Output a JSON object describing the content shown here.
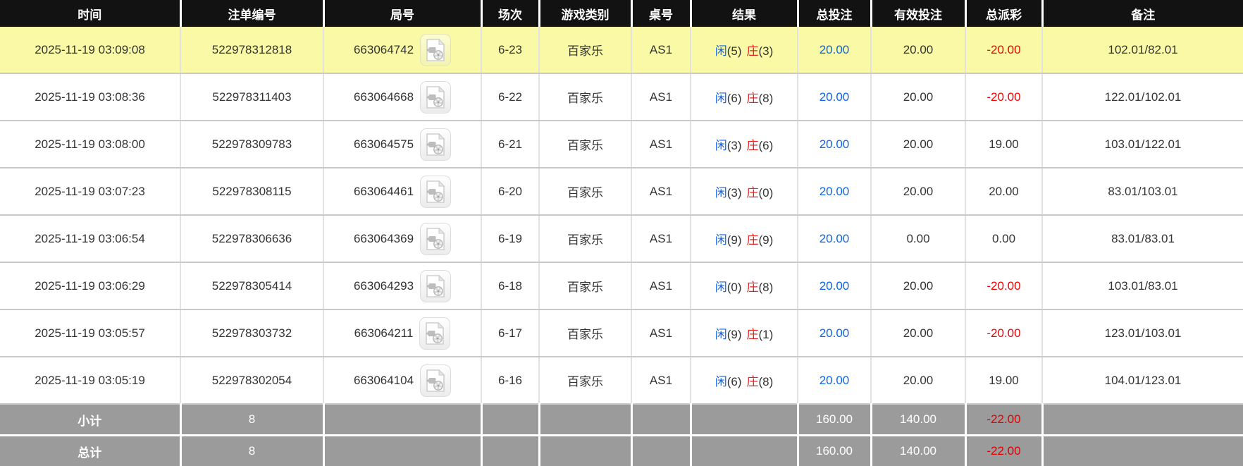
{
  "table": {
    "columns": [
      {
        "label": "时间"
      },
      {
        "label": "注单编号"
      },
      {
        "label": "局号"
      },
      {
        "label": "场次"
      },
      {
        "label": "游戏类别"
      },
      {
        "label": "桌号"
      },
      {
        "label": "结果"
      },
      {
        "label": "总投注"
      },
      {
        "label": "有效投注"
      },
      {
        "label": "总派彩"
      },
      {
        "label": "备注"
      }
    ],
    "result_labels": {
      "player": "闲",
      "banker": "庄"
    },
    "rows": [
      {
        "time": "2025-11-19 03:09:08",
        "bet_id": "522978312818",
        "round_id": "663064742",
        "session": "6-23",
        "game_type": "百家乐",
        "table_no": "AS1",
        "player": "5",
        "banker": "3",
        "total_bet": "20.00",
        "valid_bet": "20.00",
        "payout": "-20.00",
        "remark": "102.01/82.01",
        "highlighted": true
      },
      {
        "time": "2025-11-19 03:08:36",
        "bet_id": "522978311403",
        "round_id": "663064668",
        "session": "6-22",
        "game_type": "百家乐",
        "table_no": "AS1",
        "player": "6",
        "banker": "8",
        "total_bet": "20.00",
        "valid_bet": "20.00",
        "payout": "-20.00",
        "remark": "122.01/102.01",
        "highlighted": false
      },
      {
        "time": "2025-11-19 03:08:00",
        "bet_id": "522978309783",
        "round_id": "663064575",
        "session": "6-21",
        "game_type": "百家乐",
        "table_no": "AS1",
        "player": "3",
        "banker": "6",
        "total_bet": "20.00",
        "valid_bet": "20.00",
        "payout": "19.00",
        "remark": "103.01/122.01",
        "highlighted": false
      },
      {
        "time": "2025-11-19 03:07:23",
        "bet_id": "522978308115",
        "round_id": "663064461",
        "session": "6-20",
        "game_type": "百家乐",
        "table_no": "AS1",
        "player": "3",
        "banker": "0",
        "total_bet": "20.00",
        "valid_bet": "20.00",
        "payout": "20.00",
        "remark": "83.01/103.01",
        "highlighted": false
      },
      {
        "time": "2025-11-19 03:06:54",
        "bet_id": "522978306636",
        "round_id": "663064369",
        "session": "6-19",
        "game_type": "百家乐",
        "table_no": "AS1",
        "player": "9",
        "banker": "9",
        "total_bet": "20.00",
        "valid_bet": "0.00",
        "payout": "0.00",
        "remark": "83.01/83.01",
        "highlighted": false
      },
      {
        "time": "2025-11-19 03:06:29",
        "bet_id": "522978305414",
        "round_id": "663064293",
        "session": "6-18",
        "game_type": "百家乐",
        "table_no": "AS1",
        "player": "0",
        "banker": "8",
        "total_bet": "20.00",
        "valid_bet": "20.00",
        "payout": "-20.00",
        "remark": "103.01/83.01",
        "highlighted": false
      },
      {
        "time": "2025-11-19 03:05:57",
        "bet_id": "522978303732",
        "round_id": "663064211",
        "session": "6-17",
        "game_type": "百家乐",
        "table_no": "AS1",
        "player": "9",
        "banker": "1",
        "total_bet": "20.00",
        "valid_bet": "20.00",
        "payout": "-20.00",
        "remark": "123.01/103.01",
        "highlighted": false
      },
      {
        "time": "2025-11-19 03:05:19",
        "bet_id": "522978302054",
        "round_id": "663064104",
        "session": "6-16",
        "game_type": "百家乐",
        "table_no": "AS1",
        "player": "6",
        "banker": "8",
        "total_bet": "20.00",
        "valid_bet": "20.00",
        "payout": "19.00",
        "remark": "104.01/123.01",
        "highlighted": false
      }
    ],
    "footer": [
      {
        "label": "小计",
        "count": "8",
        "total_bet": "160.00",
        "valid_bet": "140.00",
        "payout": "-22.00"
      },
      {
        "label": "总计",
        "count": "8",
        "total_bet": "160.00",
        "valid_bet": "140.00",
        "payout": "-22.00"
      }
    ]
  },
  "icons": {
    "round_media_icon": "video-file-icon"
  },
  "colors": {
    "header_bg": "#121212",
    "highlight_row": "#FAFAA6",
    "footer_bg": "#9B9B9B",
    "bet_blue": "#0C64E8",
    "banker_red": "#E32222",
    "negative_red": "#F40000"
  }
}
